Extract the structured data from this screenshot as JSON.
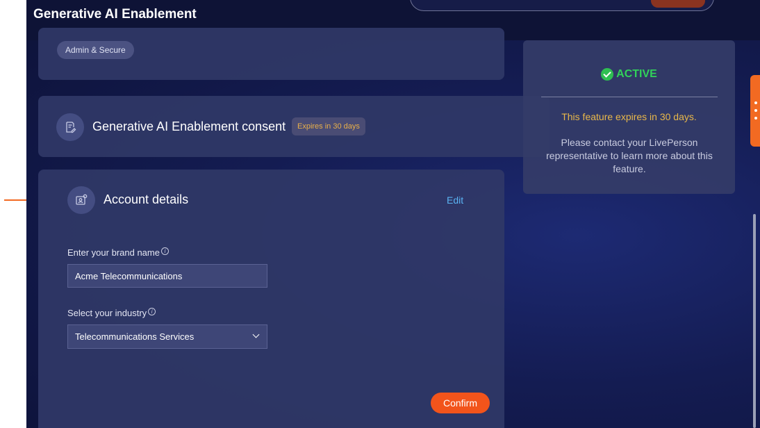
{
  "header": {
    "title": "Generative AI Enablement"
  },
  "summary_card": {
    "tag": "Admin & Secure"
  },
  "consent_card": {
    "title": "Generative AI Enablement consent",
    "badge": "Expires in 30 days",
    "icon": "document-edit-icon"
  },
  "account_card": {
    "title": "Account details",
    "icon": "account-id-icon",
    "edit_label": "Edit",
    "brand_label": "Enter your brand name",
    "brand_value": "Acme Telecommunications",
    "industry_label": "Select your industry",
    "industry_value": "Telecommunications Services",
    "confirm_label": "Confirm"
  },
  "status_panel": {
    "status": "ACTIVE",
    "expiry_text": "This feature expires in 30 days.",
    "note": "Please contact your LivePerson representative to learn more about this feature."
  },
  "colors": {
    "accent": "#f2541b",
    "active": "#31d15a",
    "warning": "#e9b84a",
    "link": "#5ab3f2"
  }
}
